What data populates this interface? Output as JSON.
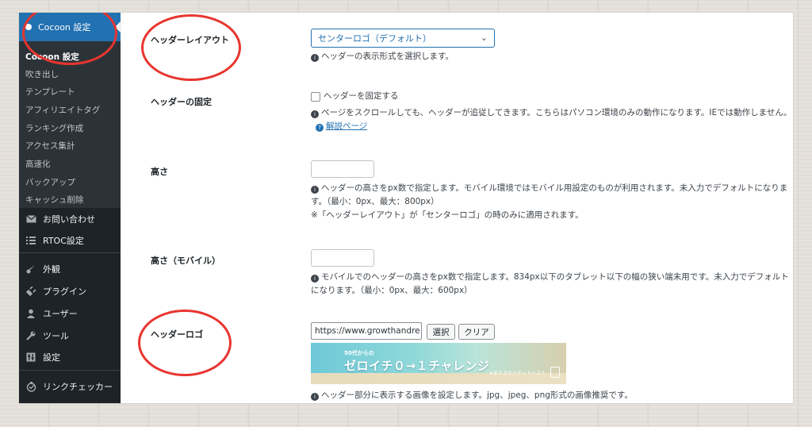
{
  "sidebar": {
    "header": "Cocoon 設定",
    "submenu": [
      {
        "label": "Cocoon 設定",
        "active": true
      },
      {
        "label": "吹き出し"
      },
      {
        "label": "テンプレート"
      },
      {
        "label": "アフィリエイトタグ"
      },
      {
        "label": "ランキング作成"
      },
      {
        "label": "アクセス集計"
      },
      {
        "label": "高速化"
      },
      {
        "label": "バックアップ"
      },
      {
        "label": "キャッシュ削除"
      }
    ],
    "menu": [
      {
        "label": "お問い合わせ",
        "icon": "mail-icon"
      },
      {
        "label": "RTOC設定",
        "icon": "list-icon"
      },
      {
        "label": "外観",
        "icon": "brush-icon"
      },
      {
        "label": "プラグイン",
        "icon": "plugin-icon"
      },
      {
        "label": "ユーザー",
        "icon": "user-icon"
      },
      {
        "label": "ツール",
        "icon": "wrench-icon"
      },
      {
        "label": "設定",
        "icon": "settings-icon"
      },
      {
        "label": "リンクチェッカー",
        "icon": "link-checker-icon"
      }
    ]
  },
  "settings": {
    "header_layout": {
      "label": "ヘッダーレイアウト",
      "value": "センターロゴ（デフォルト）",
      "desc": "ヘッダーの表示形式を選択します。"
    },
    "header_fixed": {
      "label": "ヘッダーの固定",
      "checkbox_label": "ヘッダーを固定する",
      "desc": "ページをスクロールしても、ヘッダーが追従してきます。こちらはパソコン環境のみの動作になります。IEでは動作しません。",
      "help_link": "解説ページ"
    },
    "height": {
      "label": "高さ",
      "desc": "ヘッダーの高さをpx数で指定します。モバイル環境ではモバイル用設定のものが利用されます。未入力でデフォルトになります。（最小：0px、最大：800px）",
      "note": "※「ヘッダーレイアウト」が「センターロゴ」の時のみに適用されます。"
    },
    "height_mobile": {
      "label": "高さ（モバイル）",
      "desc": "モバイルでのヘッダーの高さをpx数で指定します。834px以下のタブレット以下の幅の狭い端末用です。未入力でデフォルトになります。（最小：0px、最大：600px）"
    },
    "header_logo": {
      "label": "ヘッダーロゴ",
      "url_value": "https://www.growthandre",
      "select_button": "選択",
      "clear_button": "クリア",
      "banner_small": "50代からの",
      "banner_big": "ゼロイチ０→１チャレンジ",
      "banner_tag": "#あすきのバケットリスト",
      "desc": "ヘッダー部分に表示する画像を設定します。jpg、jpeg、png形式の画像推奨です。"
    }
  },
  "colors": {
    "sidebar_bg": "#1d2327",
    "sidebar_active": "#2271b1",
    "annotation_red": "#e8352f"
  }
}
